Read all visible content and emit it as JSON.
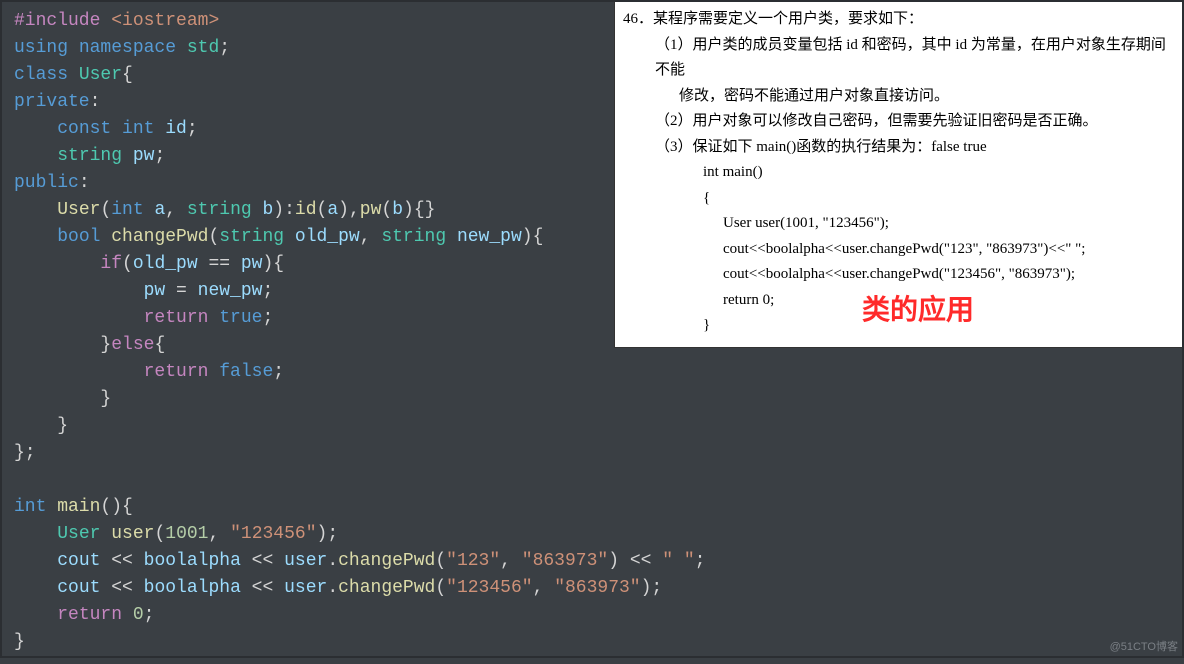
{
  "code": {
    "l1_include": "#include",
    "l1_lt": " <",
    "l1_hdr": "iostream",
    "l1_gt": ">",
    "l2_using": "using",
    "l2_ns": " namespace",
    "l2_std": " std",
    "l2_semi": ";",
    "l3_class": "class",
    "l3_user": " User",
    "l3_brace": "{",
    "l4_private": "private",
    "l4_colon": ":",
    "l5_indent": "    ",
    "l5_const": "const",
    "l5_int": " int",
    "l5_id": " id",
    "l5_semi": ";",
    "l6_indent": "    ",
    "l6_string": "string",
    "l6_pw": " pw",
    "l6_semi": ";",
    "l7_public": "public",
    "l7_colon": ":",
    "l8_indent": "    ",
    "l8_user": "User",
    "l8_open": "(",
    "l8_int": "int",
    "l8_a": " a",
    "l8_comma": ", ",
    "l8_string": "string",
    "l8_b": " b",
    "l8_close": ")",
    "l8_colon": ":",
    "l8_id": "id",
    "l8_aopen": "(",
    "l8_aarg": "a",
    "l8_aclose": ")",
    "l8_comma2": ",",
    "l8_pw": "pw",
    "l8_bopen": "(",
    "l8_barg": "b",
    "l8_bclose": ")",
    "l8_body": "{}",
    "l9_indent": "    ",
    "l9_bool": "bool",
    "l9_fn": " changePwd",
    "l9_open": "(",
    "l9_str1": "string",
    "l9_old": " old_pw",
    "l9_comma": ", ",
    "l9_str2": "string",
    "l9_new": " new_pw",
    "l9_close": ")",
    "l9_brace": "{",
    "l10_indent": "        ",
    "l10_if": "if",
    "l10_open": "(",
    "l10_old": "old_pw",
    "l10_eq": " == ",
    "l10_pw": "pw",
    "l10_close": ")",
    "l10_brace": "{",
    "l11_indent": "            ",
    "l11_pw": "pw",
    "l11_eq": " = ",
    "l11_new": "new_pw",
    "l11_semi": ";",
    "l12_indent": "            ",
    "l12_return": "return",
    "l12_true": " true",
    "l12_semi": ";",
    "l13_indent": "        ",
    "l13_close": "}",
    "l13_else": "else",
    "l13_brace": "{",
    "l14_indent": "            ",
    "l14_return": "return",
    "l14_false": " false",
    "l14_semi": ";",
    "l15_indent": "        ",
    "l15_brace": "}",
    "l16_indent": "    ",
    "l16_brace": "}",
    "l17_brace": "};",
    "l18_blank": "",
    "l19_int": "int",
    "l19_main": " main",
    "l19_parens": "()",
    "l19_brace": "{",
    "l20_indent": "    ",
    "l20_User": "User",
    "l20_user": " user",
    "l20_open": "(",
    "l20_num": "1001",
    "l20_comma": ", ",
    "l20_str": "\"123456\"",
    "l20_close": ")",
    "l20_semi": ";",
    "l21_indent": "    ",
    "l21_cout": "cout",
    "l21_lt1": " << ",
    "l21_boolalpha": "boolalpha",
    "l21_lt2": " << ",
    "l21_user": "user",
    "l21_dot": ".",
    "l21_fn": "changePwd",
    "l21_open": "(",
    "l21_s1": "\"123\"",
    "l21_comma": ", ",
    "l21_s2": "\"863973\"",
    "l21_close": ")",
    "l21_lt3": " << ",
    "l21_sp": "\" \"",
    "l21_semi": ";",
    "l22_indent": "    ",
    "l22_cout": "cout",
    "l22_lt1": " << ",
    "l22_boolalpha": "boolalpha",
    "l22_lt2": " << ",
    "l22_user": "user",
    "l22_dot": ".",
    "l22_fn": "changePwd",
    "l22_open": "(",
    "l22_s1": "\"123456\"",
    "l22_comma": ", ",
    "l22_s2": "\"863973\"",
    "l22_close": ")",
    "l22_semi": ";",
    "l23_indent": "    ",
    "l23_return": "return",
    "l23_zero": " 0",
    "l23_semi": ";",
    "l24_brace": "}"
  },
  "problem": {
    "title": "46．某程序需要定义一个用户类，要求如下：",
    "p1a": "（1）用户类的成员变量包括 id 和密码，其中 id 为常量，在用户对象生存期间不能",
    "p1b": "修改，密码不能通过用户对象直接访问。",
    "p2": "（2）用户对象可以修改自己密码，但需要先验证旧密码是否正确。",
    "p3": "（3）保证如下 main()函数的执行结果为：false true",
    "c1": "int main()",
    "c2": "{",
    "c3": "User user(1001, \"123456\");",
    "c4": "cout<<boolalpha<<user.changePwd(\"123\", \"863973\")<<\" \";",
    "c5": "cout<<boolalpha<<user.changePwd(\"123456\", \"863973\");",
    "c6": "return 0;",
    "c7": "}"
  },
  "caption": "类的应用",
  "watermark": "@51CTO博客"
}
